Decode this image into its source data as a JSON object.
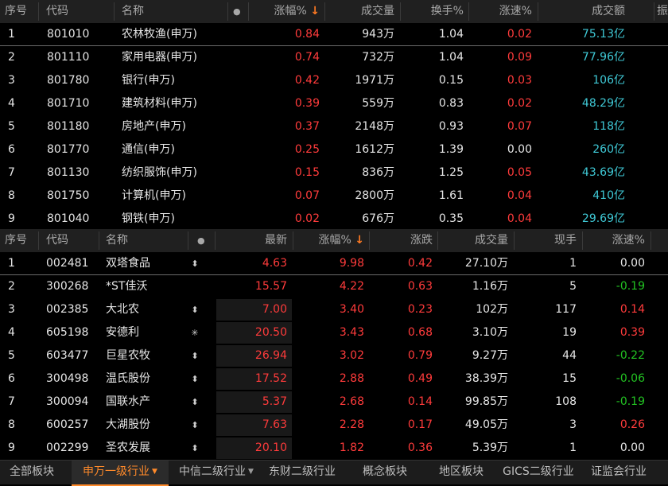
{
  "top_table": {
    "headers": {
      "no": "序号",
      "code": "代码",
      "name": "名称",
      "dot": "●",
      "pct": "涨幅%",
      "pct_arrow": "↓",
      "vol": "成交量",
      "turnover": "换手%",
      "speed": "涨速%",
      "amount": "成交额",
      "extra": "振"
    },
    "rows": [
      {
        "no": "1",
        "code": "801010",
        "name": "农林牧渔(申万)",
        "pct": "0.84",
        "vol": "943万",
        "turnover": "1.04",
        "speed": "0.02",
        "amount": "75.13亿"
      },
      {
        "no": "2",
        "code": "801110",
        "name": "家用电器(申万)",
        "pct": "0.74",
        "vol": "732万",
        "turnover": "1.04",
        "speed": "0.09",
        "amount": "77.96亿"
      },
      {
        "no": "3",
        "code": "801780",
        "name": "银行(申万)",
        "pct": "0.42",
        "vol": "1971万",
        "turnover": "0.15",
        "speed": "0.03",
        "amount": "106亿"
      },
      {
        "no": "4",
        "code": "801710",
        "name": "建筑材料(申万)",
        "pct": "0.39",
        "vol": "559万",
        "turnover": "0.83",
        "speed": "0.02",
        "amount": "48.29亿"
      },
      {
        "no": "5",
        "code": "801180",
        "name": "房地产(申万)",
        "pct": "0.37",
        "vol": "2148万",
        "turnover": "0.93",
        "speed": "0.07",
        "amount": "118亿"
      },
      {
        "no": "6",
        "code": "801770",
        "name": "通信(申万)",
        "pct": "0.25",
        "vol": "1612万",
        "turnover": "1.39",
        "speed": "0.00",
        "amount": "260亿"
      },
      {
        "no": "7",
        "code": "801130",
        "name": "纺织服饰(申万)",
        "pct": "0.15",
        "vol": "836万",
        "turnover": "1.25",
        "speed": "0.05",
        "amount": "43.69亿"
      },
      {
        "no": "8",
        "code": "801750",
        "name": "计算机(申万)",
        "pct": "0.07",
        "vol": "2800万",
        "turnover": "1.61",
        "speed": "0.04",
        "amount": "410亿"
      },
      {
        "no": "9",
        "code": "801040",
        "name": "钢铁(申万)",
        "pct": "0.02",
        "vol": "676万",
        "turnover": "0.35",
        "speed": "0.04",
        "amount": "29.69亿"
      }
    ]
  },
  "bottom_table": {
    "headers": {
      "no": "序号",
      "code": "代码",
      "name": "名称",
      "dot": "●",
      "price": "最新",
      "pct": "涨幅%",
      "pct_arrow": "↓",
      "change": "涨跌",
      "vol": "成交量",
      "cur": "现手",
      "speed": "涨速%"
    },
    "rows": [
      {
        "no": "1",
        "code": "002481",
        "name": "双塔食品",
        "flag": "⬍",
        "price": "4.63",
        "pct": "9.98",
        "change": "0.42",
        "vol": "27.10万",
        "cur": "1",
        "speed": "0.00"
      },
      {
        "no": "2",
        "code": "300268",
        "name": "*ST佳沃",
        "flag": "",
        "price": "15.57",
        "pct": "4.22",
        "change": "0.63",
        "vol": "1.16万",
        "cur": "5",
        "speed": "-0.19"
      },
      {
        "no": "3",
        "code": "002385",
        "name": "大北农",
        "flag": "⬍",
        "price": "7.00",
        "pct": "3.40",
        "change": "0.23",
        "vol": "102万",
        "cur": "117",
        "speed": "0.14"
      },
      {
        "no": "4",
        "code": "605198",
        "name": "安德利",
        "flag": "✳",
        "price": "20.50",
        "pct": "3.43",
        "change": "0.68",
        "vol": "3.10万",
        "cur": "19",
        "speed": "0.39"
      },
      {
        "no": "5",
        "code": "603477",
        "name": "巨星农牧",
        "flag": "⬍",
        "price": "26.94",
        "pct": "3.02",
        "change": "0.79",
        "vol": "9.27万",
        "cur": "44",
        "speed": "-0.22"
      },
      {
        "no": "6",
        "code": "300498",
        "name": "温氏股份",
        "flag": "⬍",
        "price": "17.52",
        "pct": "2.88",
        "change": "0.49",
        "vol": "38.39万",
        "cur": "15",
        "speed": "-0.06"
      },
      {
        "no": "7",
        "code": "300094",
        "name": "国联水产",
        "flag": "⬍",
        "price": "5.37",
        "pct": "2.68",
        "change": "0.14",
        "vol": "99.85万",
        "cur": "108",
        "speed": "-0.19"
      },
      {
        "no": "8",
        "code": "600257",
        "name": "大湖股份",
        "flag": "⬍",
        "price": "7.63",
        "pct": "2.28",
        "change": "0.17",
        "vol": "49.05万",
        "cur": "3",
        "speed": "0.26"
      },
      {
        "no": "9",
        "code": "002299",
        "name": "圣农发展",
        "flag": "⬍",
        "price": "20.10",
        "pct": "1.82",
        "change": "0.36",
        "vol": "5.39万",
        "cur": "1",
        "speed": "0.00"
      }
    ]
  },
  "tabs": [
    {
      "label": "全部板块",
      "active": false,
      "dropdown": false
    },
    {
      "label": "申万一级行业",
      "active": true,
      "dropdown": true
    },
    {
      "label": "中信二级行业",
      "active": false,
      "dropdown": true
    },
    {
      "label": "东财二级行业",
      "active": false,
      "dropdown": false
    },
    {
      "label": "概念板块",
      "active": false,
      "dropdown": false
    },
    {
      "label": "地区板块",
      "active": false,
      "dropdown": false
    },
    {
      "label": "GICS二级行业",
      "active": false,
      "dropdown": false
    },
    {
      "label": "证监会行业",
      "active": false,
      "dropdown": false
    }
  ],
  "colors": {
    "up": "#ff3b3b",
    "down": "#22c322",
    "flat": "#e6e6e6",
    "amount": "#3fc9d6",
    "accent": "#ff8a2a"
  }
}
